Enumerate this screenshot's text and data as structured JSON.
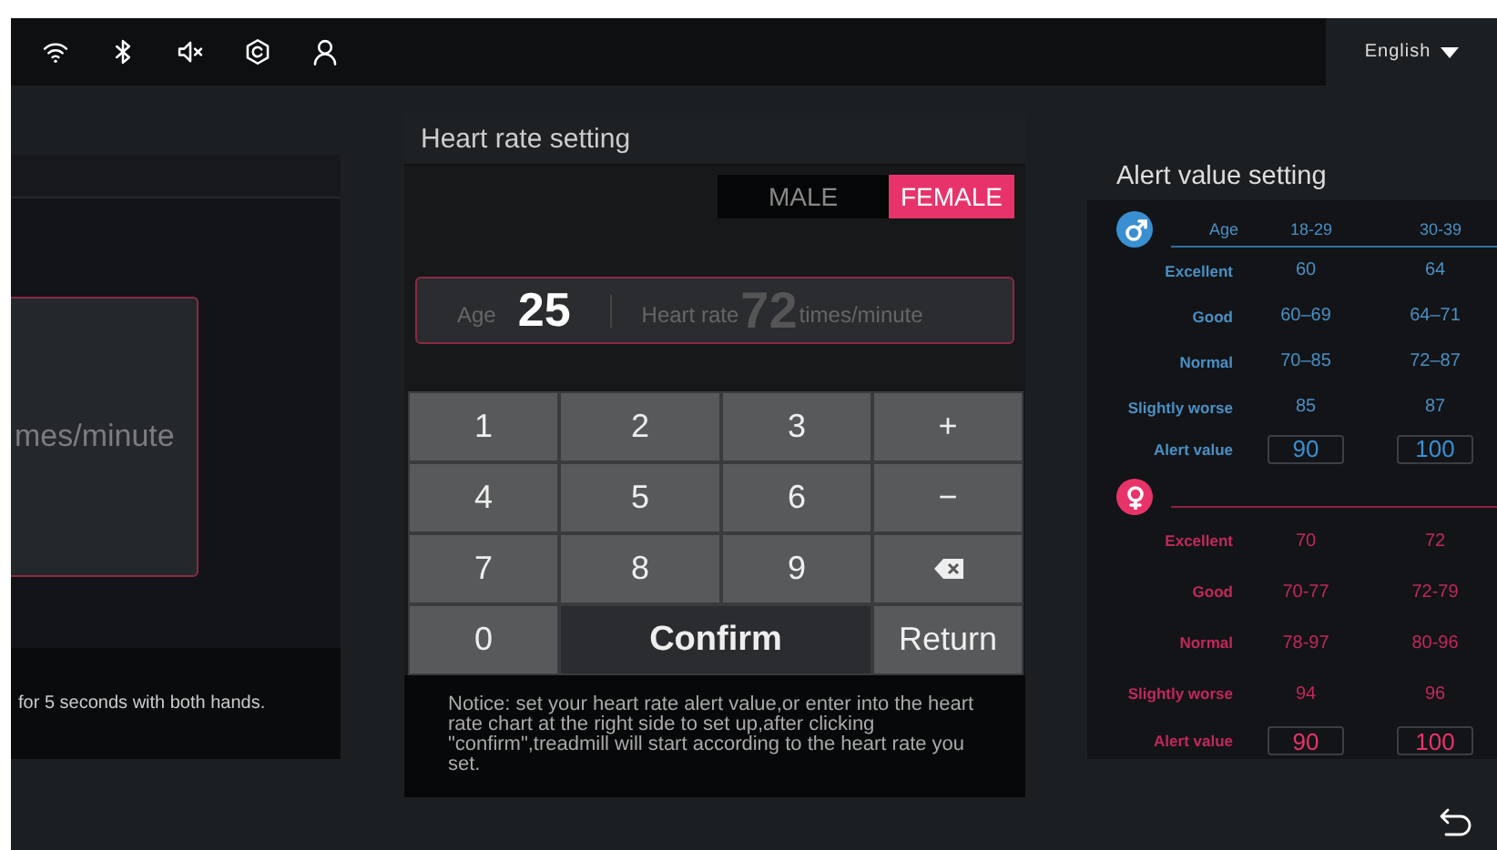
{
  "top_bar": {
    "language": "English"
  },
  "left_panel": {
    "unit": "mes/minute",
    "hint": "for 5 seconds with both hands."
  },
  "heart_rate_dialog": {
    "title": "Heart rate setting",
    "genders": [
      {
        "label": "MALE",
        "selected": false
      },
      {
        "label": "FEMALE",
        "selected": true
      }
    ],
    "age_label": "Age",
    "age": "25",
    "heart_rate_label": "Heart rate",
    "heart_rate": "72",
    "unit": "times/minute",
    "keys": [
      {
        "kind": "key",
        "label": "1"
      },
      {
        "kind": "key",
        "label": "2"
      },
      {
        "kind": "key",
        "label": "3"
      },
      {
        "kind": "key",
        "label": "+"
      },
      {
        "kind": "key",
        "label": "4"
      },
      {
        "kind": "key",
        "label": "5"
      },
      {
        "kind": "key",
        "label": "6"
      },
      {
        "kind": "key",
        "label": "−"
      },
      {
        "kind": "key",
        "label": "7"
      },
      {
        "kind": "key",
        "label": "8"
      },
      {
        "kind": "key",
        "label": "9"
      },
      {
        "kind": "backspace"
      },
      {
        "kind": "key",
        "label": "0"
      },
      {
        "kind": "confirm",
        "label": "Confirm"
      },
      {
        "kind": "key",
        "label": "Return"
      }
    ],
    "notice": "Notice:  set your heart rate alert value,or enter into the heart rate chart at the right side to set up,after clicking \"confirm\",treadmill will start according to the heart rate you set."
  },
  "alert_panel": {
    "title": "Alert value setting",
    "age_label": "Age",
    "age_groups": [
      "18-29",
      "30-39"
    ],
    "tables": [
      {
        "kind": "male",
        "rows": [
          {
            "label": "Excellent",
            "values": [
              "60",
              "64"
            ]
          },
          {
            "label": "Good",
            "values": [
              "60–69",
              "64–71"
            ]
          },
          {
            "label": "Normal",
            "values": [
              "70–85",
              "72–87"
            ]
          },
          {
            "label": "Slightly worse",
            "values": [
              "85",
              "87"
            ]
          }
        ],
        "alert_label": "Alert value",
        "alert_values": [
          "90",
          "100"
        ]
      },
      {
        "kind": "female",
        "rows": [
          {
            "label": "Excellent",
            "values": [
              "70",
              "72"
            ]
          },
          {
            "label": "Good",
            "values": [
              "70-77",
              "72-79"
            ]
          },
          {
            "label": "Normal",
            "values": [
              "78-97",
              "80-96"
            ]
          },
          {
            "label": "Slightly worse",
            "values": [
              "94",
              "96"
            ]
          }
        ],
        "alert_label": "Alert value",
        "alert_values": [
          "90",
          "100"
        ]
      }
    ]
  }
}
